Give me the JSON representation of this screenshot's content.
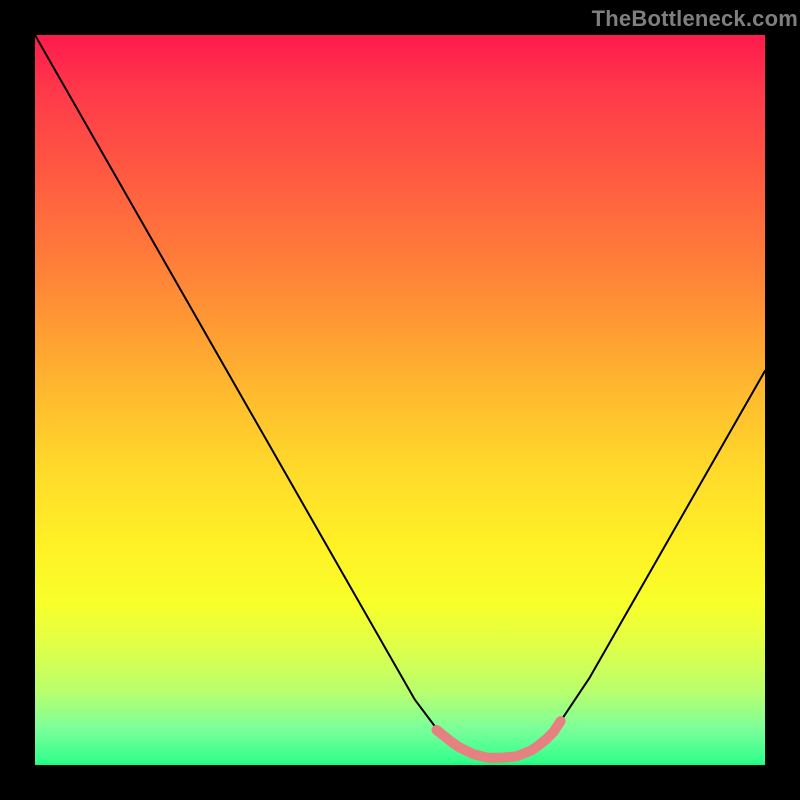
{
  "watermark": "TheBottleneck.com",
  "chart_data": {
    "type": "line",
    "title": "",
    "xlabel": "",
    "ylabel": "",
    "xlim": [
      0,
      100
    ],
    "ylim": [
      0,
      100
    ],
    "grid": false,
    "legend": false,
    "series": [
      {
        "name": "curve",
        "color": "#000000",
        "x": [
          0,
          4,
          8,
          12,
          16,
          20,
          24,
          28,
          32,
          36,
          40,
          44,
          48,
          52,
          55,
          58,
          60,
          62,
          64,
          66,
          68,
          70,
          72,
          76,
          80,
          84,
          88,
          92,
          96,
          100
        ],
        "y": [
          100,
          93,
          86,
          79,
          72,
          65,
          58,
          51,
          44,
          37,
          30,
          23,
          16,
          9,
          5,
          2.5,
          1.5,
          1,
          1,
          1.2,
          2,
          3.5,
          6,
          12,
          19,
          26,
          33,
          40,
          47,
          54
        ]
      }
    ],
    "highlight": {
      "name": "bottom-highlight",
      "color": "#e78080",
      "stroke_width": 10,
      "x": [
        55,
        56,
        57,
        58,
        60,
        62,
        64,
        66,
        68,
        69,
        70,
        71,
        72
      ],
      "y": [
        4.8,
        4.0,
        3.2,
        2.5,
        1.5,
        1.0,
        1.0,
        1.2,
        2.0,
        2.7,
        3.5,
        4.5,
        6.0
      ]
    }
  }
}
